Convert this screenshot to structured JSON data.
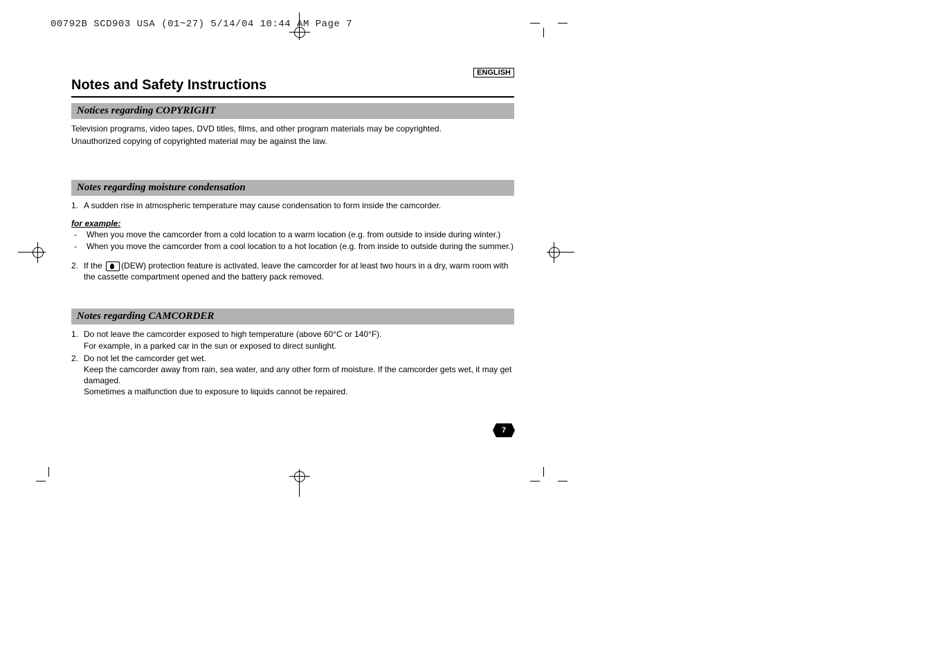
{
  "slug": "00792B SCD903 USA (01~27)  5/14/04 10:44 AM  Page 7",
  "language_box": "ENGLISH",
  "page_title": "Notes and Safety Instructions",
  "page_number": "7",
  "sections": {
    "copyright": {
      "header": "Notices regarding COPYRIGHT",
      "p1": "Television programs, video tapes, DVD titles, films, and other program materials may be copyrighted.",
      "p2": "Unauthorized copying of copyrighted material may be against the law."
    },
    "moisture": {
      "header": "Notes regarding moisture condensation",
      "item1": "A sudden rise in atmospheric temperature may cause condensation to form inside the camcorder.",
      "for_example_label": "for example:",
      "dash1": "When you move the camcorder from a cold location to a warm location (e.g. from outside to inside during winter.)",
      "dash2": "When you move the camcorder from a cool location to a hot location (e.g. from inside to outside during the summer.)",
      "item2_pre": "If the ",
      "item2_post": "(DEW) protection feature is activated, leave the camcorder for at least two hours in a dry, warm room with the cassette compartment opened and the battery pack removed."
    },
    "camcorder": {
      "header": "Notes regarding CAMCORDER",
      "item1a": "Do not leave the camcorder exposed to high temperature (above 60°C or 140°F).",
      "item1b": "For example, in a parked car in the sun or exposed to direct sunlight.",
      "item2a": "Do not let the camcorder get wet.",
      "item2b": "Keep the camcorder away from rain, sea water, and any other form of moisture. If the camcorder gets wet, it may get damaged.",
      "item2c": "Sometimes a malfunction due to exposure to liquids cannot be repaired."
    }
  }
}
